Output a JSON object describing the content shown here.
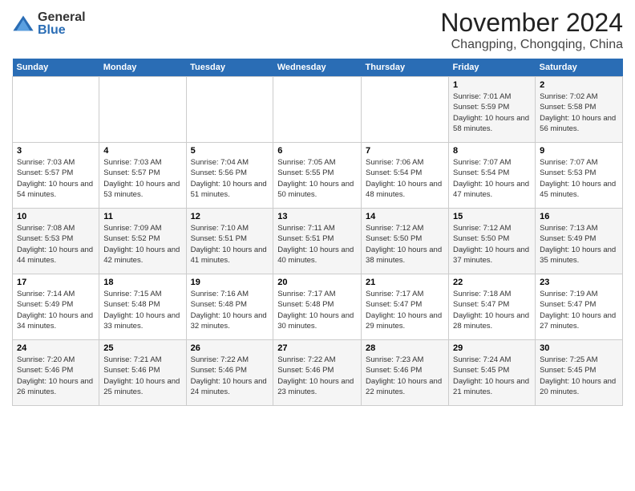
{
  "logo": {
    "general": "General",
    "blue": "Blue"
  },
  "title": "November 2024",
  "location": "Changping, Chongqing, China",
  "days_of_week": [
    "Sunday",
    "Monday",
    "Tuesday",
    "Wednesday",
    "Thursday",
    "Friday",
    "Saturday"
  ],
  "weeks": [
    [
      {
        "day": "",
        "info": ""
      },
      {
        "day": "",
        "info": ""
      },
      {
        "day": "",
        "info": ""
      },
      {
        "day": "",
        "info": ""
      },
      {
        "day": "",
        "info": ""
      },
      {
        "day": "1",
        "info": "Sunrise: 7:01 AM\nSunset: 5:59 PM\nDaylight: 10 hours and 58 minutes."
      },
      {
        "day": "2",
        "info": "Sunrise: 7:02 AM\nSunset: 5:58 PM\nDaylight: 10 hours and 56 minutes."
      }
    ],
    [
      {
        "day": "3",
        "info": "Sunrise: 7:03 AM\nSunset: 5:57 PM\nDaylight: 10 hours and 54 minutes."
      },
      {
        "day": "4",
        "info": "Sunrise: 7:03 AM\nSunset: 5:57 PM\nDaylight: 10 hours and 53 minutes."
      },
      {
        "day": "5",
        "info": "Sunrise: 7:04 AM\nSunset: 5:56 PM\nDaylight: 10 hours and 51 minutes."
      },
      {
        "day": "6",
        "info": "Sunrise: 7:05 AM\nSunset: 5:55 PM\nDaylight: 10 hours and 50 minutes."
      },
      {
        "day": "7",
        "info": "Sunrise: 7:06 AM\nSunset: 5:54 PM\nDaylight: 10 hours and 48 minutes."
      },
      {
        "day": "8",
        "info": "Sunrise: 7:07 AM\nSunset: 5:54 PM\nDaylight: 10 hours and 47 minutes."
      },
      {
        "day": "9",
        "info": "Sunrise: 7:07 AM\nSunset: 5:53 PM\nDaylight: 10 hours and 45 minutes."
      }
    ],
    [
      {
        "day": "10",
        "info": "Sunrise: 7:08 AM\nSunset: 5:53 PM\nDaylight: 10 hours and 44 minutes."
      },
      {
        "day": "11",
        "info": "Sunrise: 7:09 AM\nSunset: 5:52 PM\nDaylight: 10 hours and 42 minutes."
      },
      {
        "day": "12",
        "info": "Sunrise: 7:10 AM\nSunset: 5:51 PM\nDaylight: 10 hours and 41 minutes."
      },
      {
        "day": "13",
        "info": "Sunrise: 7:11 AM\nSunset: 5:51 PM\nDaylight: 10 hours and 40 minutes."
      },
      {
        "day": "14",
        "info": "Sunrise: 7:12 AM\nSunset: 5:50 PM\nDaylight: 10 hours and 38 minutes."
      },
      {
        "day": "15",
        "info": "Sunrise: 7:12 AM\nSunset: 5:50 PM\nDaylight: 10 hours and 37 minutes."
      },
      {
        "day": "16",
        "info": "Sunrise: 7:13 AM\nSunset: 5:49 PM\nDaylight: 10 hours and 35 minutes."
      }
    ],
    [
      {
        "day": "17",
        "info": "Sunrise: 7:14 AM\nSunset: 5:49 PM\nDaylight: 10 hours and 34 minutes."
      },
      {
        "day": "18",
        "info": "Sunrise: 7:15 AM\nSunset: 5:48 PM\nDaylight: 10 hours and 33 minutes."
      },
      {
        "day": "19",
        "info": "Sunrise: 7:16 AM\nSunset: 5:48 PM\nDaylight: 10 hours and 32 minutes."
      },
      {
        "day": "20",
        "info": "Sunrise: 7:17 AM\nSunset: 5:48 PM\nDaylight: 10 hours and 30 minutes."
      },
      {
        "day": "21",
        "info": "Sunrise: 7:17 AM\nSunset: 5:47 PM\nDaylight: 10 hours and 29 minutes."
      },
      {
        "day": "22",
        "info": "Sunrise: 7:18 AM\nSunset: 5:47 PM\nDaylight: 10 hours and 28 minutes."
      },
      {
        "day": "23",
        "info": "Sunrise: 7:19 AM\nSunset: 5:47 PM\nDaylight: 10 hours and 27 minutes."
      }
    ],
    [
      {
        "day": "24",
        "info": "Sunrise: 7:20 AM\nSunset: 5:46 PM\nDaylight: 10 hours and 26 minutes."
      },
      {
        "day": "25",
        "info": "Sunrise: 7:21 AM\nSunset: 5:46 PM\nDaylight: 10 hours and 25 minutes."
      },
      {
        "day": "26",
        "info": "Sunrise: 7:22 AM\nSunset: 5:46 PM\nDaylight: 10 hours and 24 minutes."
      },
      {
        "day": "27",
        "info": "Sunrise: 7:22 AM\nSunset: 5:46 PM\nDaylight: 10 hours and 23 minutes."
      },
      {
        "day": "28",
        "info": "Sunrise: 7:23 AM\nSunset: 5:46 PM\nDaylight: 10 hours and 22 minutes."
      },
      {
        "day": "29",
        "info": "Sunrise: 7:24 AM\nSunset: 5:45 PM\nDaylight: 10 hours and 21 minutes."
      },
      {
        "day": "30",
        "info": "Sunrise: 7:25 AM\nSunset: 5:45 PM\nDaylight: 10 hours and 20 minutes."
      }
    ]
  ]
}
